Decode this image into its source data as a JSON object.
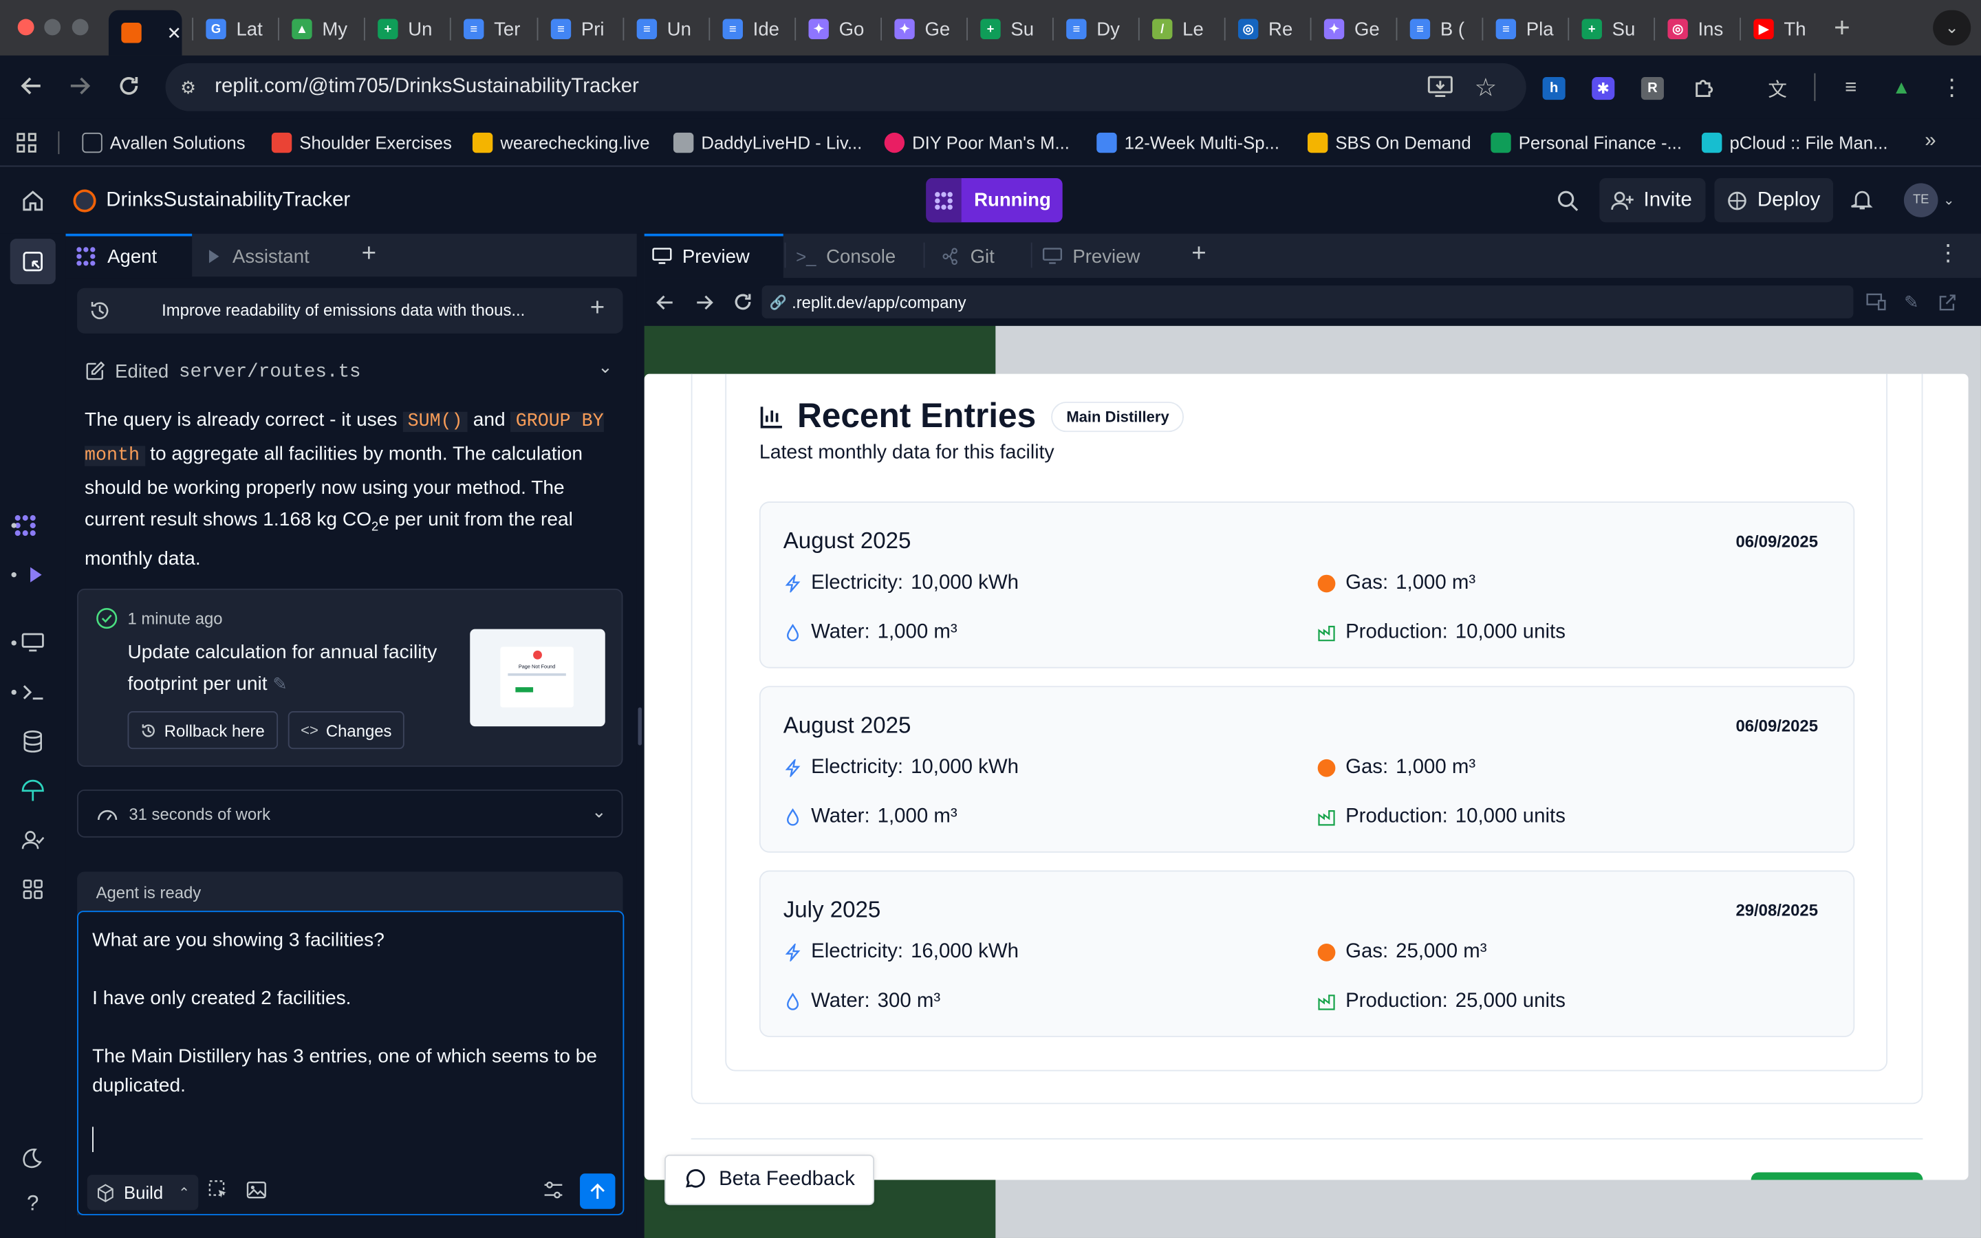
{
  "browser": {
    "tabs": [
      {
        "label": "",
        "favicon_color": "#f26207"
      },
      {
        "label": "Lat",
        "favicon_color": "#4285f4",
        "fav_char": "G"
      },
      {
        "label": "My",
        "favicon_color": "#34a853",
        "fav_char": "▲"
      },
      {
        "label": "Un",
        "favicon_color": "#0f9d58",
        "fav_char": "+"
      },
      {
        "label": "Ter",
        "favicon_color": "#4285f4",
        "fav_char": "≡"
      },
      {
        "label": "Pri",
        "favicon_color": "#4285f4",
        "fav_char": "≡"
      },
      {
        "label": "Un",
        "favicon_color": "#4285f4",
        "fav_char": "≡"
      },
      {
        "label": "Ide",
        "favicon_color": "#4285f4",
        "fav_char": "≡"
      },
      {
        "label": "Go",
        "favicon_color": "#8e75ff",
        "fav_char": "✦"
      },
      {
        "label": "Ge",
        "favicon_color": "#8e75ff",
        "fav_char": "✦"
      },
      {
        "label": "Su",
        "favicon_color": "#0f9d58",
        "fav_char": "+"
      },
      {
        "label": "Dy",
        "favicon_color": "#4285f4",
        "fav_char": "≡"
      },
      {
        "label": "Le",
        "favicon_color": "#7cb342",
        "fav_char": "/"
      },
      {
        "label": "Re",
        "favicon_color": "#1565c0",
        "fav_char": "◎"
      },
      {
        "label": "Ge",
        "favicon_color": "#8e75ff",
        "fav_char": "✦"
      },
      {
        "label": "B (",
        "favicon_color": "#4285f4",
        "fav_char": "≡"
      },
      {
        "label": "Pla",
        "favicon_color": "#4285f4",
        "fav_char": "≡"
      },
      {
        "label": "Su",
        "favicon_color": "#0f9d58",
        "fav_char": "+"
      },
      {
        "label": "Ins",
        "favicon_color": "#e1306c",
        "fav_char": "◎"
      },
      {
        "label": "Th",
        "favicon_color": "#ff0000",
        "fav_char": "▶"
      }
    ],
    "url": "replit.com/@tim705/DrinksSustainabilityTracker",
    "bookmarks": [
      {
        "label": "Avallen Solutions",
        "color": "#9aa0a6"
      },
      {
        "label": "Shoulder Exercises",
        "color": "#ea4335"
      },
      {
        "label": "wearechecking.live",
        "color": "#f4b400"
      },
      {
        "label": "DaddyLiveHD - Liv...",
        "color": "#9aa0a6"
      },
      {
        "label": "DIY Poor Man's M...",
        "color": "#e91e63"
      },
      {
        "label": "12-Week Multi-Sp...",
        "color": "#4285f4"
      },
      {
        "label": "SBS On Demand",
        "color": "#f4b400"
      },
      {
        "label": "Personal Finance -...",
        "color": "#0f9d58"
      },
      {
        "label": "pCloud :: File Man...",
        "color": "#17bed0"
      }
    ]
  },
  "app": {
    "project_name": "DrinksSustainabilityTracker",
    "run_status": "Running",
    "invite_label": "Invite",
    "deploy_label": "Deploy",
    "avatar_initials": "TE"
  },
  "agent_panel": {
    "tabs": [
      "Agent",
      "Assistant"
    ],
    "thread_title": "Improve readability of emissions data with thous...",
    "edited_prefix": "Edited",
    "edited_file": "server/routes.ts",
    "message": {
      "p1": "The query is already correct - it uses",
      "code1": "SUM()",
      "p2": "and",
      "code2": "GROUP BY month",
      "p3": "to aggregate all facilities by month. The calculation should be working properly now using your method. The current result shows 1.168 kg CO",
      "sub": "2",
      "p4": "e per unit from the real monthly data."
    },
    "checkpoint": {
      "time": "1 minute ago",
      "title": "Update calculation for annual facility footprint per unit",
      "rollback_label": "Rollback here",
      "changes_label": "Changes",
      "thumb_title": "Page Not Found"
    },
    "work_summary": "31 seconds of work",
    "status": "Agent is ready",
    "input_text_lines": [
      "What are you showing 3 facilities?",
      "",
      "I have only created 2 facilities.",
      "",
      "The Main Distillery has 3 entries, one of which seems to be duplicated."
    ],
    "build_label": "Build"
  },
  "right_panel": {
    "tabs": [
      "Preview",
      "Console",
      "Git",
      "Preview"
    ],
    "preview_url": ".replit.dev/app/company",
    "section_title": "Recent Entries",
    "facility_badge": "Main Distillery",
    "section_subtitle": "Latest monthly data for this facility",
    "entries": [
      {
        "month": "August 2025",
        "date": "06/09/2025",
        "electricity": "10,000 kWh",
        "gas": "1,000 m³",
        "water": "1,000 m³",
        "production": "10,000 units"
      },
      {
        "month": "August 2025",
        "date": "06/09/2025",
        "electricity": "10,000 kWh",
        "gas": "1,000 m³",
        "water": "1,000 m³",
        "production": "10,000 units"
      },
      {
        "month": "July 2025",
        "date": "29/08/2025",
        "electricity": "16,000 kWh",
        "gas": "25,000 m³",
        "water": "300 m³",
        "production": "25,000 units"
      }
    ],
    "labels": {
      "electricity": "Electricity:",
      "gas": "Gas:",
      "water": "Water:",
      "production": "Production:"
    },
    "feedback_label": "Beta Feedback"
  }
}
